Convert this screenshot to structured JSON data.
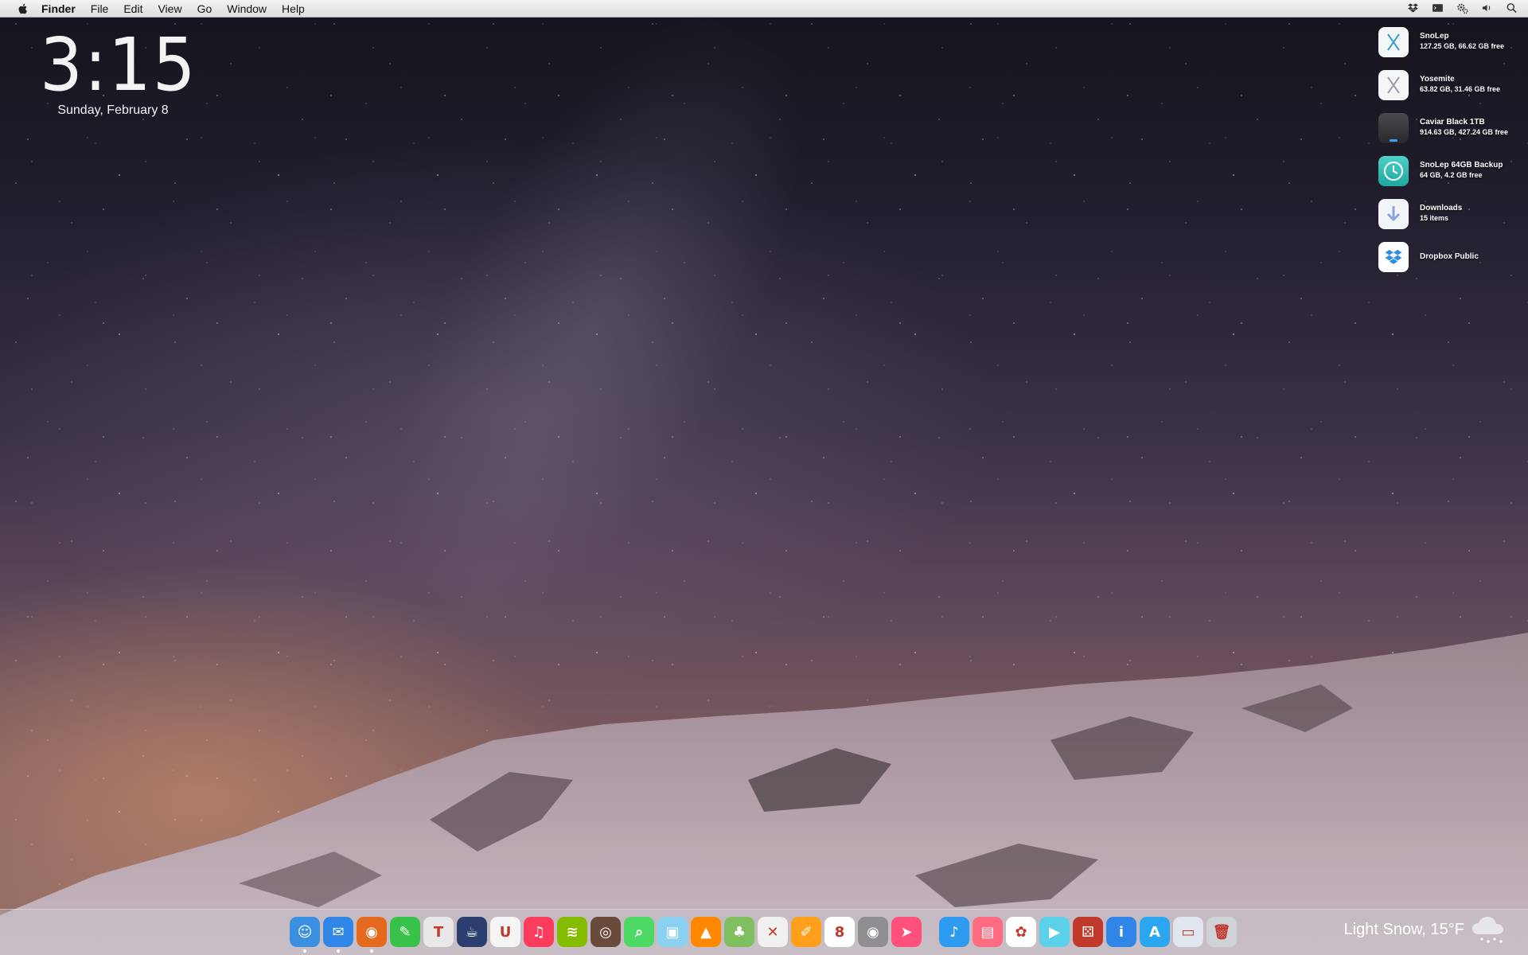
{
  "menubar": {
    "apple_icon": "apple-logo-icon",
    "app_name": "Finder",
    "items": [
      "File",
      "Edit",
      "View",
      "Go",
      "Window",
      "Help"
    ],
    "status_icons": [
      "dropbox-icon",
      "terminal-icon",
      "gears-icon",
      "volume-icon",
      "spotlight-search-icon"
    ]
  },
  "clock": {
    "time": "3:15",
    "date": "Sunday, February  8"
  },
  "desktop_items": [
    {
      "name": "SnoLep",
      "detail": "127.25 GB, 66.62 GB free",
      "icon": "osx-x-drive-icon"
    },
    {
      "name": "Yosemite",
      "detail": "63.82 GB, 31.46 GB free",
      "icon": "osx-x-drive-icon"
    },
    {
      "name": "Caviar Black 1TB",
      "detail": "914.63 GB, 427.24 GB free",
      "icon": "external-drive-icon"
    },
    {
      "name": "SnoLep 64GB Backup",
      "detail": "64 GB, 4.2 GB free",
      "icon": "time-machine-icon"
    },
    {
      "name": "Downloads",
      "detail": "15 items",
      "icon": "downloads-folder-icon"
    },
    {
      "name": "Dropbox Public",
      "detail": "",
      "icon": "dropbox-folder-icon"
    }
  ],
  "dock": {
    "apps": [
      {
        "icon": "finder-icon",
        "color": "#3b8fe0",
        "glyph": "☺",
        "running": true
      },
      {
        "icon": "mail-icon",
        "color": "#2f86e6",
        "glyph": "✉",
        "running": true
      },
      {
        "icon": "firefox-icon",
        "color": "#e66a1e",
        "glyph": "◉",
        "running": true
      },
      {
        "icon": "messages-icon",
        "color": "#39c24a",
        "glyph": "✎",
        "running": false
      },
      {
        "icon": "text-tool-icon",
        "color": "#e8e8e8",
        "glyph": "T",
        "running": false
      },
      {
        "icon": "caffeine-icon",
        "color": "#2c3e70",
        "glyph": "☕",
        "running": false
      },
      {
        "icon": "magnet-icon",
        "color": "#f4f4f4",
        "glyph": "U",
        "running": false
      },
      {
        "icon": "music-icon",
        "color": "#fc3c5c",
        "glyph": "♫",
        "running": false
      },
      {
        "icon": "spotify-icon",
        "color": "#84bd00",
        "glyph": "≋",
        "running": false
      },
      {
        "icon": "camera-lens-icon",
        "color": "#6a4a3a",
        "glyph": "◎",
        "running": false
      },
      {
        "icon": "search-magnifier-icon",
        "color": "#4cd964",
        "glyph": "⌕",
        "running": false
      },
      {
        "icon": "preview-icon",
        "color": "#8ad0f0",
        "glyph": "▣",
        "running": false
      },
      {
        "icon": "vlc-icon",
        "color": "#ff8800",
        "glyph": "▲",
        "running": false
      },
      {
        "icon": "game-icon",
        "color": "#7fbf5f",
        "glyph": "♣",
        "running": false
      },
      {
        "icon": "x-tool-icon",
        "color": "#f0f0f0",
        "glyph": "✕",
        "running": false
      },
      {
        "icon": "pages-icon",
        "color": "#ff9f1a",
        "glyph": "✐",
        "running": false
      },
      {
        "icon": "calendar-icon",
        "color": "#ffffff",
        "glyph": "8",
        "running": false
      },
      {
        "icon": "camera-icon",
        "color": "#8e8e93",
        "glyph": "◉",
        "running": false
      },
      {
        "icon": "airmail-icon",
        "color": "#ff4f7b",
        "glyph": "➤",
        "running": false
      },
      {
        "icon": "headphones-icon",
        "color": "#2f9bf0",
        "glyph": "♪",
        "running": false
      },
      {
        "icon": "notes-pink-icon",
        "color": "#ff6b81",
        "glyph": "▤",
        "running": false
      },
      {
        "icon": "photos-icon",
        "color": "#ffffff",
        "glyph": "✿",
        "running": false
      },
      {
        "icon": "clapper-icon",
        "color": "#5ad1e8",
        "glyph": "▶",
        "running": false
      },
      {
        "icon": "dice-icon",
        "color": "#c0392b",
        "glyph": "⚄",
        "running": false
      },
      {
        "icon": "info-icon",
        "color": "#2f86e6",
        "glyph": "i",
        "running": false
      },
      {
        "icon": "app-store-icon",
        "color": "#2aa7f0",
        "glyph": "A",
        "running": false
      },
      {
        "icon": "window-preview-icon",
        "color": "#dfe6ee",
        "glyph": "▭",
        "running": false
      },
      {
        "icon": "trash-icon",
        "color": "#cfd3d8",
        "glyph": "🗑",
        "running": false
      }
    ]
  },
  "weather": {
    "text": "Light Snow, 15°F",
    "icon": "snow-cloud-icon"
  }
}
